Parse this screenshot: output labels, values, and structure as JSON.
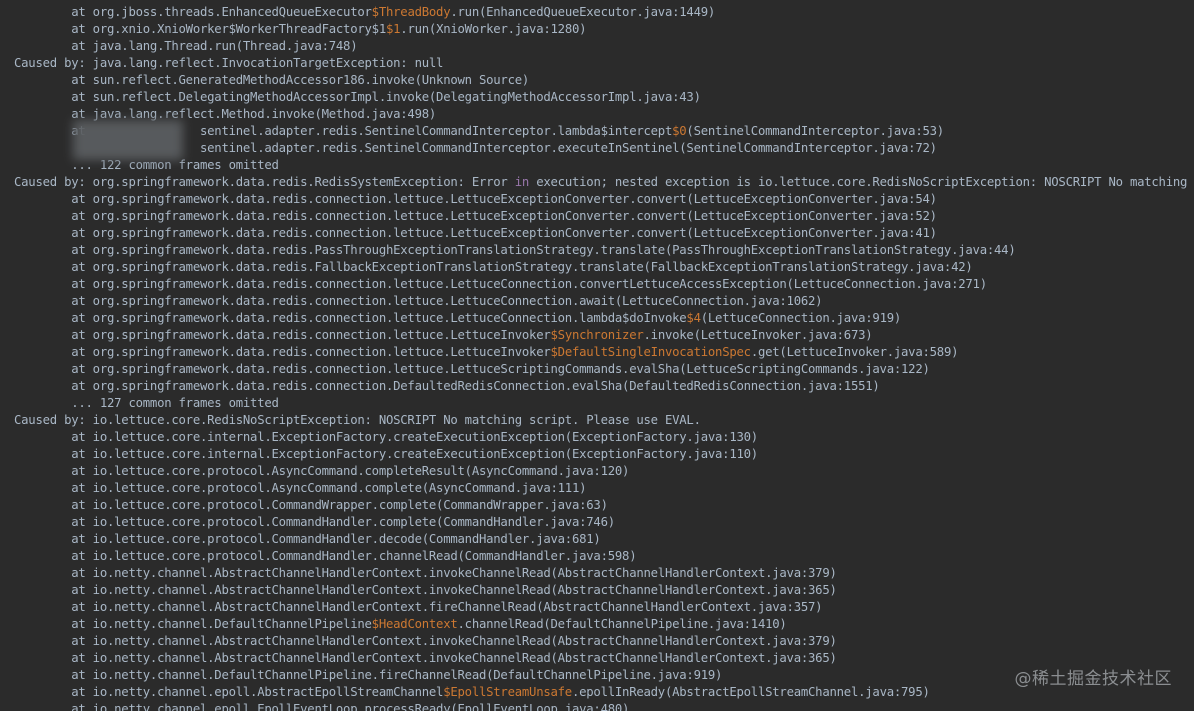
{
  "console": {
    "lines": [
      {
        "segments": [
          {
            "text": "        at org.jboss.threads.EnhancedQueueExecutor"
          },
          {
            "text": "$ThreadBody",
            "hl": true
          },
          {
            "text": ".run(EnhancedQueueExecutor.java:1449)"
          }
        ]
      },
      {
        "segments": [
          {
            "text": "        at org.xnio.XnioWorker$WorkerThreadFactory$1"
          },
          {
            "text": "$1",
            "hl": true
          },
          {
            "text": ".run(XnioWorker.java:1280)"
          }
        ]
      },
      {
        "segments": [
          {
            "text": "        at java.lang.Thread.run(Thread.java:748)"
          }
        ]
      },
      {
        "segments": [
          {
            "text": "Caused by: java.lang.reflect.InvocationTargetException: null"
          }
        ]
      },
      {
        "segments": [
          {
            "text": "        at sun.reflect.GeneratedMethodAccessor186.invoke(Unknown Source)"
          }
        ]
      },
      {
        "segments": [
          {
            "text": "        at sun.reflect.DelegatingMethodAccessorImpl.invoke(DelegatingMethodAccessorImpl.java:43)"
          }
        ]
      },
      {
        "segments": [
          {
            "text": "        at java.lang.reflect.Method.invoke(Method.java:498)"
          }
        ]
      },
      {
        "segments": [
          {
            "text": "        at                sentinel.adapter.redis.SentinelCommandInterceptor.lambda$intercept"
          },
          {
            "text": "$0",
            "hl": true
          },
          {
            "text": "(SentinelCommandInterceptor.java:53)"
          }
        ]
      },
      {
        "segments": [
          {
            "text": "                          sentinel.adapter.redis.SentinelCommandInterceptor.executeInSentinel(SentinelCommandInterceptor.java:72)"
          }
        ]
      },
      {
        "segments": [
          {
            "text": "        ... 122 common frames omitted"
          }
        ]
      },
      {
        "segments": [
          {
            "text": "Caused by: org.springframework.data.redis.RedisSystemException: Error "
          },
          {
            "text": "in",
            "kw": true
          },
          {
            "text": " execution; nested exception is io.lettuce.core.RedisNoScriptException: NOSCRIPT No matching script. Please use EVAL."
          }
        ]
      },
      {
        "segments": [
          {
            "text": "        at org.springframework.data.redis.connection.lettuce.LettuceExceptionConverter.convert(LettuceExceptionConverter.java:54)"
          }
        ]
      },
      {
        "segments": [
          {
            "text": "        at org.springframework.data.redis.connection.lettuce.LettuceExceptionConverter.convert(LettuceExceptionConverter.java:52)"
          }
        ]
      },
      {
        "segments": [
          {
            "text": "        at org.springframework.data.redis.connection.lettuce.LettuceExceptionConverter.convert(LettuceExceptionConverter.java:41)"
          }
        ]
      },
      {
        "segments": [
          {
            "text": "        at org.springframework.data.redis.PassThroughExceptionTranslationStrategy.translate(PassThroughExceptionTranslationStrategy.java:44)"
          }
        ]
      },
      {
        "segments": [
          {
            "text": "        at org.springframework.data.redis.FallbackExceptionTranslationStrategy.translate(FallbackExceptionTranslationStrategy.java:42)"
          }
        ]
      },
      {
        "segments": [
          {
            "text": "        at org.springframework.data.redis.connection.lettuce.LettuceConnection.convertLettuceAccessException(LettuceConnection.java:271)"
          }
        ]
      },
      {
        "segments": [
          {
            "text": "        at org.springframework.data.redis.connection.lettuce.LettuceConnection.await(LettuceConnection.java:1062)"
          }
        ]
      },
      {
        "segments": [
          {
            "text": "        at org.springframework.data.redis.connection.lettuce.LettuceConnection.lambda$doInvoke"
          },
          {
            "text": "$4",
            "hl": true
          },
          {
            "text": "(LettuceConnection.java:919)"
          }
        ]
      },
      {
        "segments": [
          {
            "text": "        at org.springframework.data.redis.connection.lettuce.LettuceInvoker"
          },
          {
            "text": "$Synchronizer",
            "hl": true
          },
          {
            "text": ".invoke(LettuceInvoker.java:673)"
          }
        ]
      },
      {
        "segments": [
          {
            "text": "        at org.springframework.data.redis.connection.lettuce.LettuceInvoker"
          },
          {
            "text": "$DefaultSingleInvocationSpec",
            "hl": true
          },
          {
            "text": ".get(LettuceInvoker.java:589)"
          }
        ]
      },
      {
        "segments": [
          {
            "text": "        at org.springframework.data.redis.connection.lettuce.LettuceScriptingCommands.evalSha(LettuceScriptingCommands.java:122)"
          }
        ]
      },
      {
        "segments": [
          {
            "text": "        at org.springframework.data.redis.connection.DefaultedRedisConnection.evalSha(DefaultedRedisConnection.java:1551)"
          }
        ]
      },
      {
        "segments": [
          {
            "text": "        ... 127 common frames omitted"
          }
        ]
      },
      {
        "segments": [
          {
            "text": "Caused by: io.lettuce.core.RedisNoScriptException: NOSCRIPT No matching script. Please use EVAL."
          }
        ]
      },
      {
        "segments": [
          {
            "text": "        at io.lettuce.core.internal.ExceptionFactory.createExecutionException(ExceptionFactory.java:130)"
          }
        ]
      },
      {
        "segments": [
          {
            "text": "        at io.lettuce.core.internal.ExceptionFactory.createExecutionException(ExceptionFactory.java:110)"
          }
        ]
      },
      {
        "segments": [
          {
            "text": "        at io.lettuce.core.protocol.AsyncCommand.completeResult(AsyncCommand.java:120)"
          }
        ]
      },
      {
        "segments": [
          {
            "text": "        at io.lettuce.core.protocol.AsyncCommand.complete(AsyncCommand.java:111)"
          }
        ]
      },
      {
        "segments": [
          {
            "text": "        at io.lettuce.core.protocol.CommandWrapper.complete(CommandWrapper.java:63)"
          }
        ]
      },
      {
        "segments": [
          {
            "text": "        at io.lettuce.core.protocol.CommandHandler.complete(CommandHandler.java:746)"
          }
        ]
      },
      {
        "segments": [
          {
            "text": "        at io.lettuce.core.protocol.CommandHandler.decode(CommandHandler.java:681)"
          }
        ]
      },
      {
        "segments": [
          {
            "text": "        at io.lettuce.core.protocol.CommandHandler.channelRead(CommandHandler.java:598)"
          }
        ]
      },
      {
        "segments": [
          {
            "text": "        at io.netty.channel.AbstractChannelHandlerContext.invokeChannelRead(AbstractChannelHandlerContext.java:379)"
          }
        ]
      },
      {
        "segments": [
          {
            "text": "        at io.netty.channel.AbstractChannelHandlerContext.invokeChannelRead(AbstractChannelHandlerContext.java:365)"
          }
        ]
      },
      {
        "segments": [
          {
            "text": "        at io.netty.channel.AbstractChannelHandlerContext.fireChannelRead(AbstractChannelHandlerContext.java:357)"
          }
        ]
      },
      {
        "segments": [
          {
            "text": "        at io.netty.channel.DefaultChannelPipeline"
          },
          {
            "text": "$HeadContext",
            "hl": true
          },
          {
            "text": ".channelRead(DefaultChannelPipeline.java:1410)"
          }
        ]
      },
      {
        "segments": [
          {
            "text": "        at io.netty.channel.AbstractChannelHandlerContext.invokeChannelRead(AbstractChannelHandlerContext.java:379)"
          }
        ]
      },
      {
        "segments": [
          {
            "text": "        at io.netty.channel.AbstractChannelHandlerContext.invokeChannelRead(AbstractChannelHandlerContext.java:365)"
          }
        ]
      },
      {
        "segments": [
          {
            "text": "        at io.netty.channel.DefaultChannelPipeline.fireChannelRead(DefaultChannelPipeline.java:919)"
          }
        ]
      },
      {
        "segments": [
          {
            "text": "        at io.netty.channel.epoll.AbstractEpollStreamChannel"
          },
          {
            "text": "$EpollStreamUnsafe",
            "hl": true
          },
          {
            "text": ".epollInReady(AbstractEpollStreamChannel.java:795)"
          }
        ]
      },
      {
        "segments": [
          {
            "text": "        at io.netty.channel.epoll.EpollEventLoop.processReady(EpollEventLoop.java:480)"
          }
        ]
      }
    ],
    "watermark": "@稀土掘金技术社区"
  },
  "colors": {
    "background": "#2b2b2b",
    "text": "#a9b7c6",
    "highlight": "#cc7832",
    "keyword": "#9876aa"
  }
}
